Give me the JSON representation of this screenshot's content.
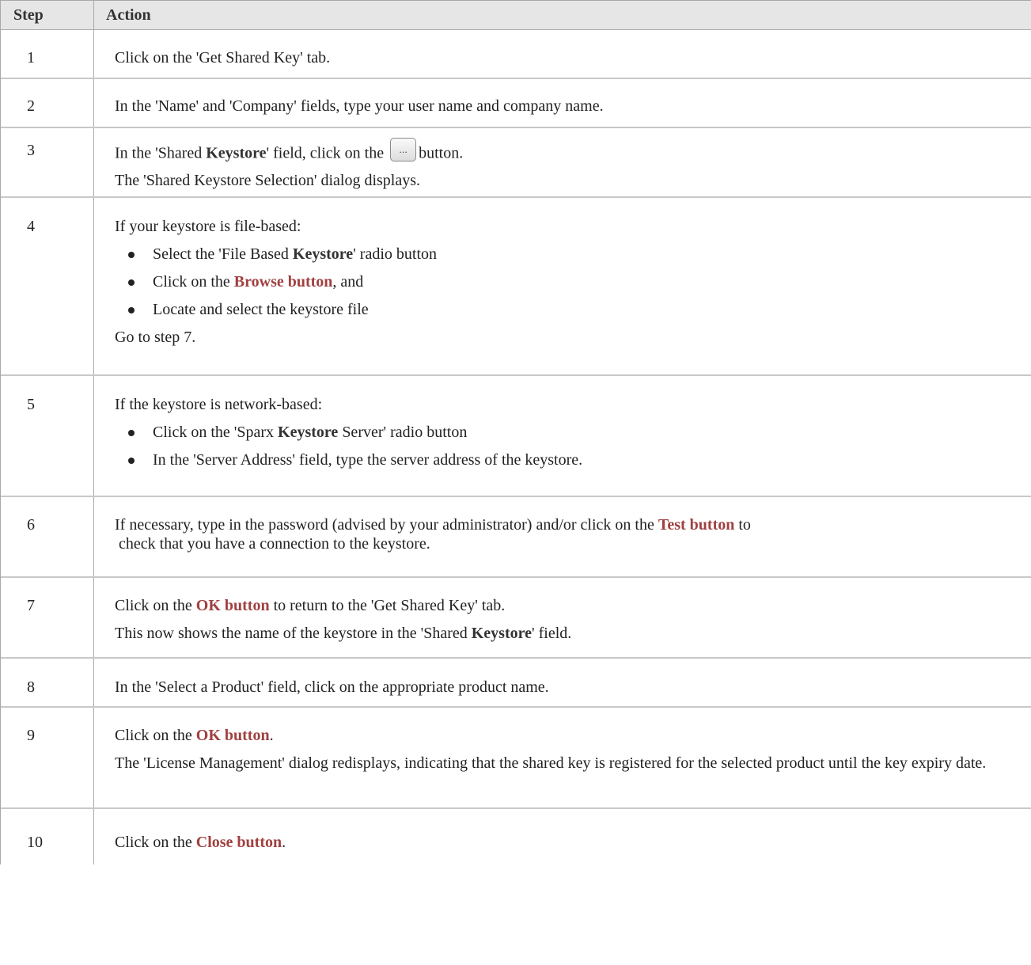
{
  "header": {
    "step": "Step",
    "action": "Action"
  },
  "rows": [
    {
      "step": "1",
      "a": "Click on the 'Get Shared Key' tab."
    },
    {
      "step": "2",
      "a": "In the 'Name' and 'Company' fields, type your user name and company name."
    },
    {
      "step": "3",
      "a1": "In the 'Shared ",
      "a1b": "Keystore",
      "a1c": "' field, click on the",
      "a1d": "button.",
      "a2": "The 'Shared Keystore Selection' dialog displays."
    },
    {
      "step": "4",
      "intro": "If your keystore is file-based:",
      "b1a": "Select the 'File Based ",
      "b1b": "Keystore",
      "b1c": "' radio button",
      "b2a": "Click on the ",
      "b2b": "Browse button",
      "b2c": ", and",
      "b3": "Locate and select the keystore file",
      "outro": "Go to step 7."
    },
    {
      "step": "5",
      "intro": "If the keystore is network-based:",
      "b1a": "Click on the 'Sparx ",
      "b1b": "Keystore",
      "b1c": " Server' radio button",
      "b2": "In the 'Server Address' field, type the server address of the keystore."
    },
    {
      "step": "6",
      "a1": "If necessary, type in the password (advised by your administrator) and/or click on the ",
      "a1b": "Test button",
      "a1c": " to",
      "a2": " check that you have a connection to the keystore."
    },
    {
      "step": "7",
      "a1": "Click on the ",
      "a1b": "OK button",
      "a1c": " to return to the 'Get Shared Key' tab.",
      "a2": "This now shows the name of the keystore in the 'Shared ",
      "a2b": "Keystore",
      "a2c": "' field."
    },
    {
      "step": "8",
      "a": "In the 'Select a Product' field, click on the appropriate product name."
    },
    {
      "step": "9",
      "a1": "Click on the ",
      "a1b": "OK button",
      "a1c": ".",
      "a2": "The 'License Management' dialog redisplays, indicating that the shared key is registered for the selected product until the key expiry date."
    },
    {
      "step": "10",
      "a1": "Click on the ",
      "a1b": "Close button",
      "a1c": "."
    }
  ],
  "colors": {
    "header_bg": "#e6e6e6",
    "link": "#a04040",
    "border": "#a9a9a9"
  }
}
